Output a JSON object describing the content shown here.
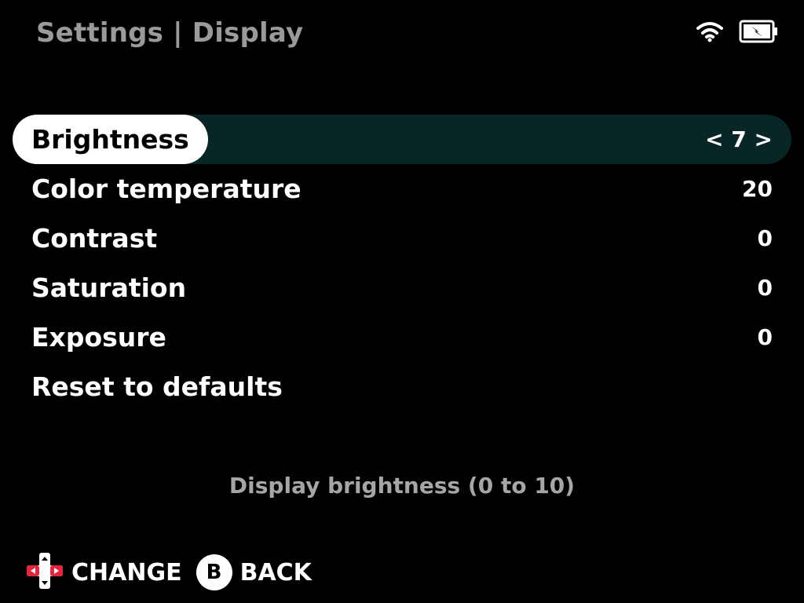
{
  "header": {
    "title": "Settings | Display"
  },
  "status_bar": {
    "wifi_icon": "wifi-icon",
    "battery_icon": "battery-charging-icon"
  },
  "menu": {
    "items": [
      {
        "label": "Brightness",
        "value": "< 7 >",
        "selected": true
      },
      {
        "label": "Color temperature",
        "value": "20",
        "selected": false
      },
      {
        "label": "Contrast",
        "value": "0",
        "selected": false
      },
      {
        "label": "Saturation",
        "value": "0",
        "selected": false
      },
      {
        "label": "Exposure",
        "value": "0",
        "selected": false
      },
      {
        "label": "Reset to defaults",
        "value": "",
        "selected": false
      }
    ]
  },
  "hint": "Display brightness (0 to 10)",
  "footer": {
    "change_label": "CHANGE",
    "back_button": "B",
    "back_label": "BACK"
  },
  "colors": {
    "selected_row_bg": "#082626",
    "dpad_accent": "#e8243c",
    "title_gray": "#9a9a9a"
  }
}
